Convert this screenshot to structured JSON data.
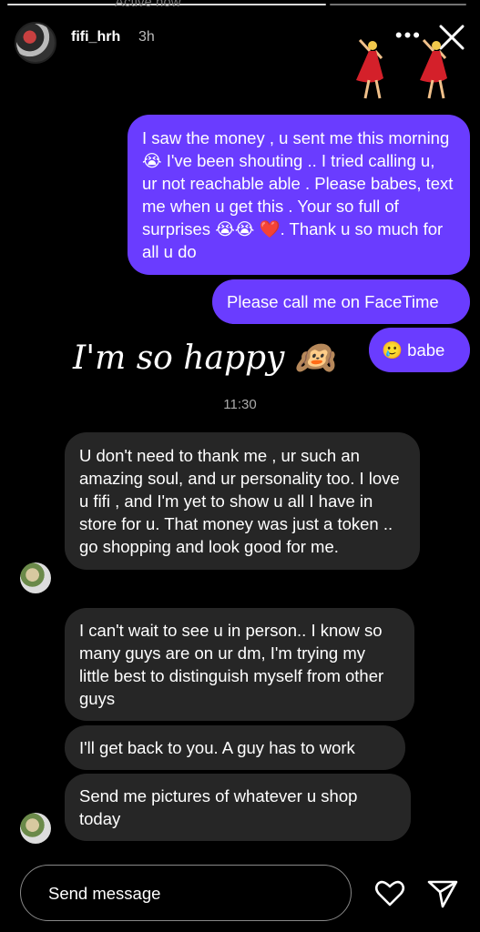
{
  "story": {
    "ghost_label": "Active now",
    "username": "fifi_hrh",
    "time_ago": "3h"
  },
  "messages": [
    {
      "dir": "out",
      "text": "I saw the money , u sent me this morning 😭 I've been shouting .. I tried calling u, ur not reachable able . Please babes, text me when u get this . Your so full of surprises 😭😭 ❤️. Thank u so much for all u do"
    },
    {
      "dir": "out",
      "text": "Please call me on FaceTime"
    },
    {
      "dir": "out",
      "text": "🥲 babe"
    },
    {
      "dir": "in",
      "text": "U don't need to thank me , ur such an amazing soul, and ur personality too.  I love u fifi , and I'm yet to show u all I have in store for u. That money was just a token .. go shopping and look good for me."
    },
    {
      "dir": "in",
      "text": "I can't wait to see u in person.. I know so many guys are on ur dm, I'm trying my little best to distinguish myself from other guys"
    },
    {
      "dir": "in",
      "text": "I'll get back to you. A guy has to work"
    },
    {
      "dir": "in",
      "text": "Send me pictures of whatever u shop today"
    }
  ],
  "overlay_text": "I'm so happy 🙉",
  "timestamp": "11:30",
  "composer": {
    "placeholder": "Send message"
  },
  "colors": {
    "outgoing_bubble": "#6a3cff",
    "incoming_bubble": "#262626",
    "background": "#000000"
  },
  "icons": [
    "more-icon",
    "close-icon",
    "heart-icon",
    "send-icon"
  ]
}
